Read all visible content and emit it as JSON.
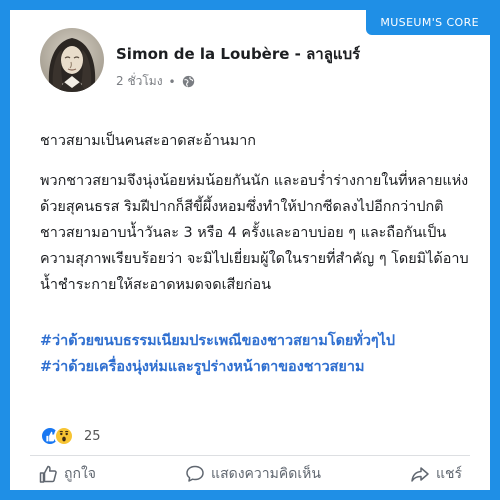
{
  "brand": {
    "label": "MUSEUM'S CORE"
  },
  "post": {
    "author": "Simon de la Loubère - ลาลูแบร์",
    "time": "2 ชั่วโมง",
    "separator": "•",
    "heading": "ชาวสยามเป็นคนสะอาดสะอ้านมาก",
    "body": "พวกชาวสยามจึงนุ่งน้อยห่มน้อยกันนัก และอบร่ำร่างกายในที่หลายแห่งด้วยสุคนธรส ริมฝีปากก็สีขี้ผึ้งหอมซึ่งทำให้ปากซีดลงไปอีกกว่าปกติ ชาวสยามอาบน้ำวันละ 3 หรือ 4 ครั้งและอาบบ่อย ๆ และถือกันเป็นความสุภาพเรียบร้อยว่า จะมิไปเยี่ยมผู้ใดในรายที่สำคัญ ๆ โดยมิได้อาบน้ำชำระกายให้สะอาดหมดจดเสียก่อน",
    "hashtags": [
      "#ว่าด้วยขนบธรรมเนียมประเพณีของชาวสยามโดยทั่วๆไป",
      "#ว่าด้วยเครื่องนุ่งห่มและรูปร่างหน้าตาของชาวสยาม"
    ]
  },
  "reactions": {
    "icons": [
      "like-icon",
      "wow-icon"
    ],
    "count": "25",
    "colors": {
      "like": "#1877f2",
      "wow": "#f7c433"
    }
  },
  "actions": {
    "like": "ถูกใจ",
    "comment": "แสดงความคิดเห็น",
    "share": "แชร์"
  },
  "colors": {
    "background": "#1f8fe6",
    "hashtag": "#2f6fd0",
    "text": "#1c1e21",
    "muted": "#7a7d82"
  }
}
